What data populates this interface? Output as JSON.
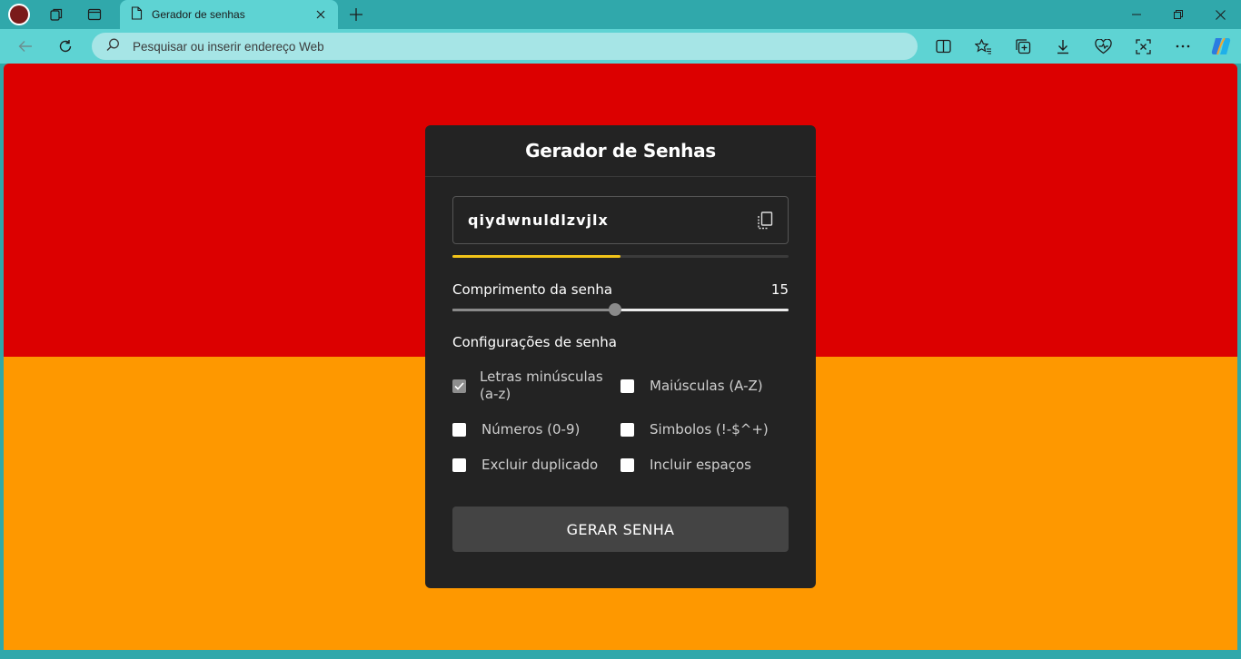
{
  "browser": {
    "tab_title": "Gerador de senhas",
    "address_placeholder": "Pesquisar ou inserir endereço Web"
  },
  "app": {
    "title": "Gerador de Senhas",
    "password": "qiydwnuldlzvjlx",
    "strength_fraction": 0.5,
    "strength_color": "#f2c419",
    "length_label": "Comprimento da senha",
    "length_value": "15",
    "length_fraction": 0.485,
    "settings_label": "Configurações de senha",
    "options": [
      {
        "label": "Letras minúsculas (a-z)",
        "checked": true
      },
      {
        "label": "Maiúsculas (A-Z)",
        "checked": false
      },
      {
        "label": "Números (0-9)",
        "checked": false
      },
      {
        "label": "Simbolos (!-$^+)",
        "checked": false
      },
      {
        "label": "Excluir duplicado",
        "checked": false
      },
      {
        "label": "Incluir espaços",
        "checked": false
      }
    ],
    "generate_label": "GERAR SENHA"
  },
  "colors": {
    "bg_top": "#dc0000",
    "bg_bottom": "#fe9800",
    "card": "#232323",
    "chrome": "#5ed3d3"
  },
  "icons": [
    "profile-avatar",
    "workspaces-icon",
    "tab-actions-icon",
    "page-icon",
    "close-icon",
    "plus-icon",
    "back-icon",
    "refresh-icon",
    "search-icon",
    "split-screen-icon",
    "favorites-icon",
    "collections-icon",
    "download-icon",
    "browser-essentials-icon",
    "screenshot-icon",
    "more-icon",
    "copilot-icon",
    "copy-icon"
  ]
}
